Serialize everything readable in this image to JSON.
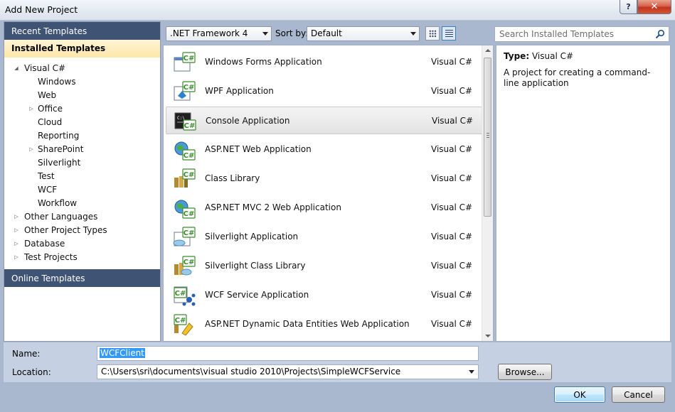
{
  "window": {
    "title": "Add New Project",
    "help_label": "?",
    "close_label": "✕"
  },
  "left": {
    "recent": "Recent Templates",
    "installed": "Installed Templates",
    "online": "Online Templates",
    "tree": [
      {
        "label": "Visual C#",
        "level": 0,
        "arrow": "expanded"
      },
      {
        "label": "Windows",
        "level": 1,
        "arrow": "none"
      },
      {
        "label": "Web",
        "level": 1,
        "arrow": "none"
      },
      {
        "label": "Office",
        "level": 1,
        "arrow": "collapsed"
      },
      {
        "label": "Cloud",
        "level": 1,
        "arrow": "none"
      },
      {
        "label": "Reporting",
        "level": 1,
        "arrow": "none"
      },
      {
        "label": "SharePoint",
        "level": 1,
        "arrow": "collapsed"
      },
      {
        "label": "Silverlight",
        "level": 1,
        "arrow": "none"
      },
      {
        "label": "Test",
        "level": 1,
        "arrow": "none"
      },
      {
        "label": "WCF",
        "level": 1,
        "arrow": "none"
      },
      {
        "label": "Workflow",
        "level": 1,
        "arrow": "none"
      },
      {
        "label": "Other Languages",
        "level": 0,
        "arrow": "collapsed"
      },
      {
        "label": "Other Project Types",
        "level": 0,
        "arrow": "collapsed"
      },
      {
        "label": "Database",
        "level": 0,
        "arrow": "collapsed"
      },
      {
        "label": "Test Projects",
        "level": 0,
        "arrow": "collapsed"
      }
    ]
  },
  "toolbar": {
    "framework": ".NET Framework 4",
    "sort_label": "Sort by:",
    "sort_value": "Default",
    "search_placeholder": "Search Installed Templates"
  },
  "templates": [
    {
      "name": "Windows Forms Application",
      "lang": "Visual C#",
      "icon": "windows-forms-icon",
      "selected": false
    },
    {
      "name": "WPF Application",
      "lang": "Visual C#",
      "icon": "wpf-icon",
      "selected": false
    },
    {
      "name": "Console Application",
      "lang": "Visual C#",
      "icon": "console-icon",
      "selected": true
    },
    {
      "name": "ASP.NET Web Application",
      "lang": "Visual C#",
      "icon": "aspnet-web-icon",
      "selected": false
    },
    {
      "name": "Class Library",
      "lang": "Visual C#",
      "icon": "class-library-icon",
      "selected": false
    },
    {
      "name": "ASP.NET MVC 2 Web Application",
      "lang": "Visual C#",
      "icon": "aspnet-mvc-icon",
      "selected": false
    },
    {
      "name": "Silverlight Application",
      "lang": "Visual C#",
      "icon": "silverlight-icon",
      "selected": false
    },
    {
      "name": "Silverlight Class Library",
      "lang": "Visual C#",
      "icon": "silverlight-library-icon",
      "selected": false
    },
    {
      "name": "WCF Service Application",
      "lang": "Visual C#",
      "icon": "wcf-service-icon",
      "selected": false
    },
    {
      "name": "ASP.NET Dynamic Data Entities Web Application",
      "lang": "Visual C#",
      "icon": "dynamic-data-icon",
      "selected": false
    }
  ],
  "description": {
    "type_label": "Type:",
    "type_value": "Visual C#",
    "text": "A project for creating a command-line application"
  },
  "form": {
    "name_label": "Name:",
    "name_value": "WCFClient",
    "location_label": "Location:",
    "location_value": "C:\\Users\\sri\\documents\\visual studio 2010\\Projects\\SimpleWCFService",
    "browse_label": "Browse..."
  },
  "buttons": {
    "ok": "OK",
    "cancel": "Cancel"
  },
  "colors": {
    "header_navy": "#3f5375",
    "selection_gold": "#fde7a8",
    "csharp_green": "#3c8c2e"
  }
}
